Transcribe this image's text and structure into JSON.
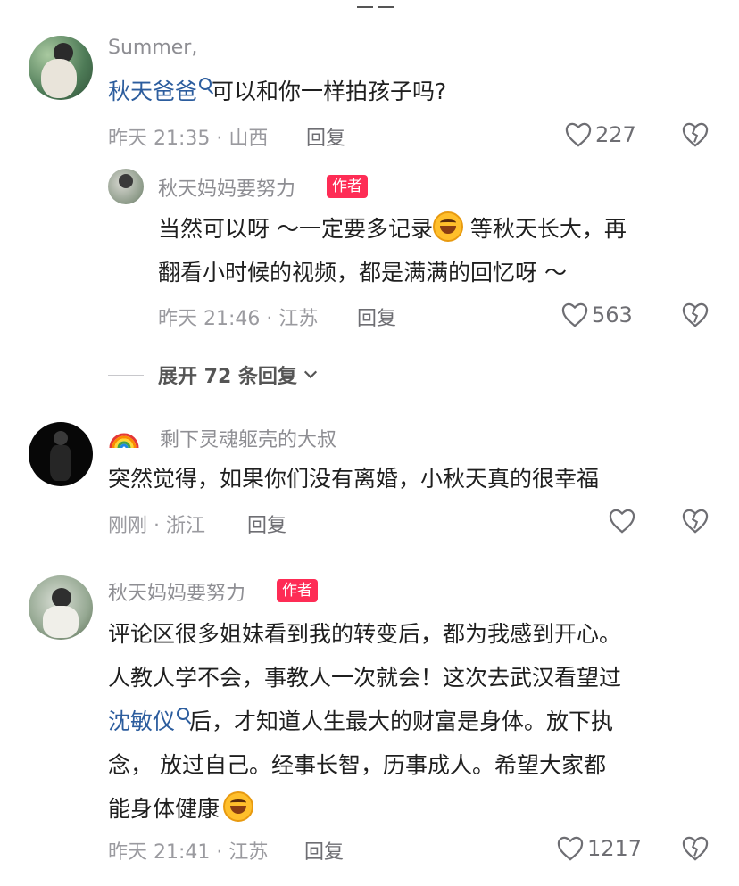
{
  "comments": [
    {
      "user": "Summer,",
      "mention": "秋天爸爸",
      "text": "可以和你一样拍孩子吗?",
      "meta": "昨天 21:35 · 山西",
      "reply_label": "回复",
      "likes": "227",
      "reply": {
        "user": "秋天妈妈要努力",
        "author_tag": "作者",
        "line1a": "当然可以呀 ～一定要多记录",
        "line1b": " 等秋天长大，再",
        "line2": "翻看小时候的视频，都是满满的回忆呀 ～",
        "meta": "昨天 21:46 · 江苏",
        "reply_label": "回复",
        "likes": "563"
      },
      "expand_label": "展开 72 条回复"
    },
    {
      "user": "剩下灵魂躯壳的大叔",
      "text": "突然觉得，如果你们没有离婚，小秋天真的很幸福",
      "meta": "刚刚 · 浙江",
      "reply_label": "回复"
    },
    {
      "user": "秋天妈妈要努力",
      "author_tag": "作者",
      "line1": "评论区很多姐妹看到我的转变后，都为我感到开心。",
      "line2": "人教人学不会，事教人一次就会！这次去武汉看望过",
      "line3_mention": "沈敏仪",
      "line3": "后，才知道人生最大的财富是身体。放下执",
      "line4": "念，  放过自己。经事长智，历事成人。希望大家都",
      "line5": "能身体健康",
      "meta": "昨天 21:41 · 江苏",
      "reply_label": "回复",
      "likes": "1217"
    }
  ],
  "icons": {
    "heart": "heart-icon",
    "dislike": "broken-heart-icon",
    "mention": "search-mention-icon",
    "chevron": "chevron-down-icon",
    "rainbow": "rainbow-icon"
  },
  "colors": {
    "author_tag": "#fe2c55",
    "mention": "#2c5d9e",
    "meta": "#9a9a9f"
  }
}
